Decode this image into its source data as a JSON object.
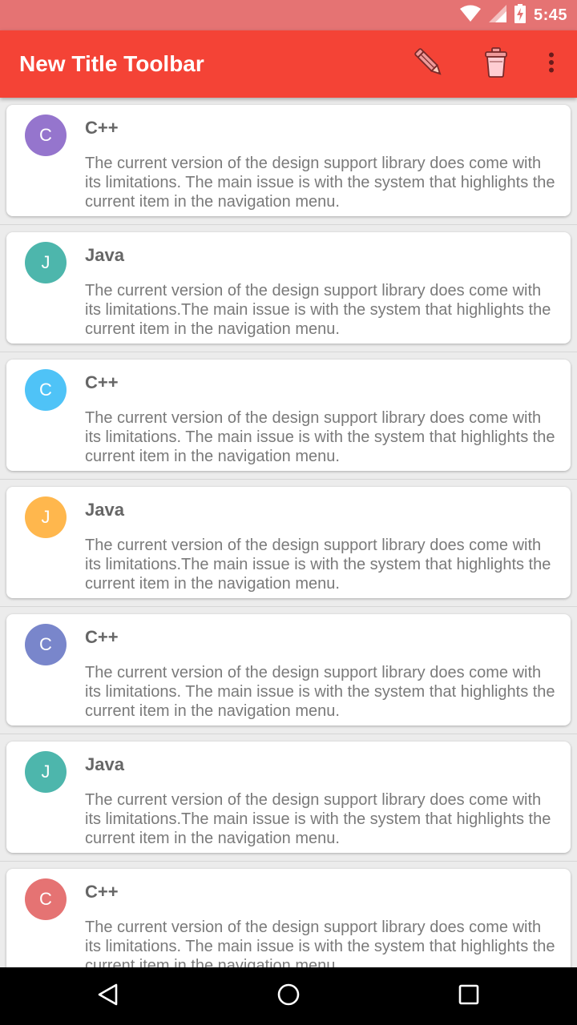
{
  "status_bar": {
    "time": "5:45",
    "icons": [
      "wifi-icon",
      "cell-signal-icon",
      "battery-charging-icon"
    ]
  },
  "toolbar": {
    "title": "New Title Toolbar",
    "actions": [
      "edit-pencil-icon",
      "delete-trash-icon",
      "more-vert-icon"
    ],
    "color": "#f44336"
  },
  "items": [
    {
      "initial": "C",
      "title": "C++",
      "color": "#9575cd",
      "description": "The current version of the design support library does come with its limitations. The main issue is with the system that highlights the current item in the navigation menu."
    },
    {
      "initial": "J",
      "title": "Java",
      "color": "#4db6ac",
      "description": "The current version of the design support library does come with its limitations.The main issue is with the system that highlights the current item in the navigation menu."
    },
    {
      "initial": "C",
      "title": "C++",
      "color": "#4fc3f7",
      "description": "The current version of the design support library does come with its limitations. The main issue is with the system that highlights the current item in the navigation menu."
    },
    {
      "initial": "J",
      "title": "Java",
      "color": "#ffb74d",
      "description": "The current version of the design support library does come with its limitations.The main issue is with the system that highlights the current item in the navigation menu."
    },
    {
      "initial": "C",
      "title": "C++",
      "color": "#7986cb",
      "description": "The current version of the design support library does come with its limitations. The main issue is with the system that highlights the current item in the navigation menu."
    },
    {
      "initial": "J",
      "title": "Java",
      "color": "#4db6ac",
      "description": "The current version of the design support library does come with its limitations.The main issue is with the system that highlights the current item in the navigation menu."
    },
    {
      "initial": "C",
      "title": "C++",
      "color": "#e57373",
      "description": "The current version of the design support library does come with its limitations. The main issue is with the system that highlights the current item in the navigation menu."
    }
  ],
  "nav_bar": {
    "buttons": [
      "back-icon",
      "home-icon",
      "recents-icon"
    ]
  }
}
